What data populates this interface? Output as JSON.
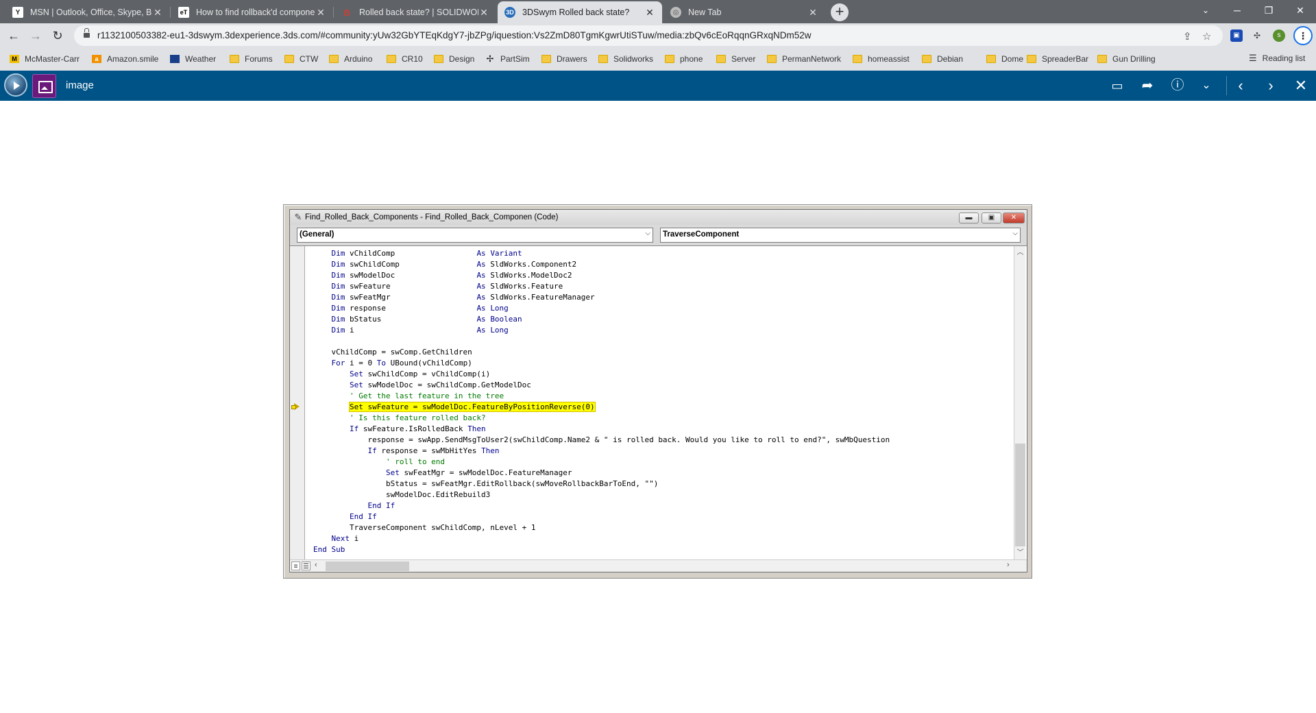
{
  "browser": {
    "tabs": [
      {
        "title": "MSN | Outlook, Office, Skype, Bi",
        "favicon": "msn-logo",
        "active": false
      },
      {
        "title": "How to find rollback'd compone",
        "favicon": "eng-tips-logo",
        "active": false
      },
      {
        "title": "Rolled back state? | SOLIDWORK",
        "favicon": "solidworks-logo",
        "active": false
      },
      {
        "title": "3DSwym Rolled back state?",
        "favicon": "3dswym-logo",
        "active": true
      },
      {
        "title": "New Tab",
        "favicon": "chrome-logo",
        "active": false
      }
    ],
    "new_tab_symbol": "+",
    "url": "r1132100503382-eu1-3dswym.3dexperience.3ds.com/#community:yUw32GbYTEqKdgY7-jbZPg/iquestion:Vs2ZmD80TgmKgwrUtiSTuw/media:zbQv6cEoRqqnGRxqNDm52w",
    "profile_initial": "s",
    "bookmarks": [
      {
        "label": "McMaster-Carr",
        "icon": "mcmaster-icon"
      },
      {
        "label": "Amazon.smile",
        "icon": "amazon-icon"
      },
      {
        "label": "Weather",
        "icon": "weather-icon"
      },
      {
        "label": "Forums",
        "icon": "folder-icon"
      },
      {
        "label": "CTW",
        "icon": "folder-icon"
      },
      {
        "label": "Arduino",
        "icon": "folder-icon"
      },
      {
        "label": "CR10",
        "icon": "folder-icon"
      },
      {
        "label": "Design",
        "icon": "folder-icon"
      },
      {
        "label": "PartSim",
        "icon": "partsim-icon"
      },
      {
        "label": "Drawers",
        "icon": "folder-icon"
      },
      {
        "label": "Solidworks",
        "icon": "folder-icon"
      },
      {
        "label": "phone",
        "icon": "folder-icon"
      },
      {
        "label": "Server",
        "icon": "folder-icon"
      },
      {
        "label": "PermanNetwork",
        "icon": "folder-icon"
      },
      {
        "label": "homeassist",
        "icon": "folder-icon"
      },
      {
        "label": "Debian",
        "icon": "folder-icon"
      },
      {
        "label": "Dome",
        "icon": "folder-icon"
      },
      {
        "label": "SpreaderBar",
        "icon": "folder-icon"
      },
      {
        "label": "Gun Drilling",
        "icon": "folder-icon"
      }
    ],
    "reading_list": "Reading list"
  },
  "app": {
    "title": "image",
    "accent_color": "#005386"
  },
  "vbe": {
    "title": "Find_Rolled_Back_Components - Find_Rolled_Back_Componen (Code)",
    "object_combo": "(General)",
    "procedure_combo": "TraverseComponent",
    "code_lines": [
      "    Dim vChildComp                  As Variant",
      "    Dim swChildComp                 As SldWorks.Component2",
      "    Dim swModelDoc                  As SldWorks.ModelDoc2",
      "    Dim swFeature                   As SldWorks.Feature",
      "    Dim swFeatMgr                   As SldWorks.FeatureManager",
      "    Dim response                    As Long",
      "    Dim bStatus                     As Boolean",
      "    Dim i                           As Long",
      "",
      "    vChildComp = swComp.GetChildren",
      "    For i = 0 To UBound(vChildComp)",
      "        Set swChildComp = vChildComp(i)",
      "        Set swModelDoc = swChildComp.GetModelDoc",
      "        ' Get the last feature in the tree",
      "        Set swFeature = swModelDoc.FeatureByPositionReverse(0)",
      "        ' Is this feature rolled back?",
      "        If swFeature.IsRolledBack Then",
      "            response = swApp.SendMsgToUser2(swChildComp.Name2 & \" is rolled back. Would you like to roll to end?\", swMbQuestion",
      "            If response = swMbHitYes Then",
      "                ' roll to end",
      "                Set swFeatMgr = swModelDoc.FeatureManager",
      "                bStatus = swFeatMgr.EditRollback(swMoveRollbackBarToEnd, \"\")",
      "                swModelDoc.EditRebuild3",
      "            End If",
      "        End If",
      "        TraverseComponent swChildComp, nLevel + 1",
      "    Next i",
      "End Sub"
    ],
    "highlight_line": 14
  }
}
